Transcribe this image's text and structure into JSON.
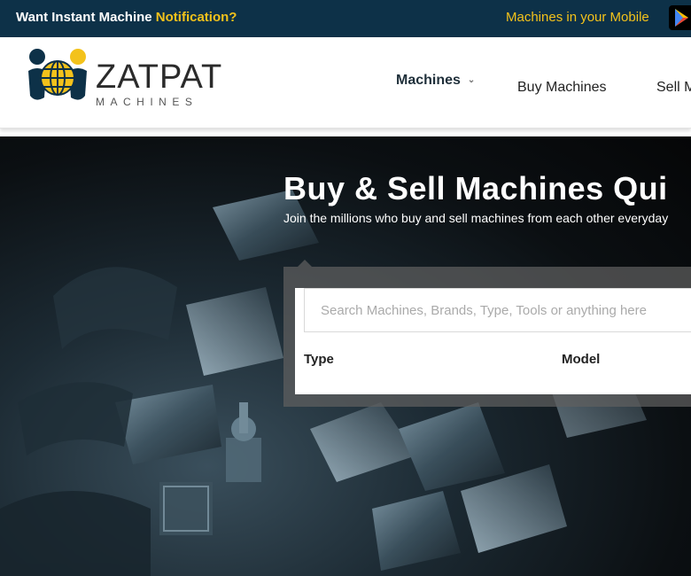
{
  "topbar": {
    "prompt_prefix": "Want Instant Machine ",
    "prompt_highlight": "Notification?",
    "mobile_text": "Machines in your Mobile",
    "colors": {
      "background": "#0d3148",
      "accent": "#f3c21b"
    },
    "store_icon": "google-play-icon"
  },
  "header": {
    "logo_word": "ZATPAT",
    "logo_sub": "MACHINES",
    "logo_icon": "globe-people-icon",
    "nav": {
      "machines": "Machines",
      "buy": "Buy Machines",
      "sell": "Sell M"
    }
  },
  "hero": {
    "title": "Buy & Sell Machines Qui",
    "subtitle": "Join the millions who buy and sell machines from each other everyday",
    "search": {
      "placeholder": "Search Machines, Brands, Type, Tools or anything here",
      "value": ""
    },
    "filters": {
      "type_label": "Type",
      "model_label": "Model"
    }
  }
}
